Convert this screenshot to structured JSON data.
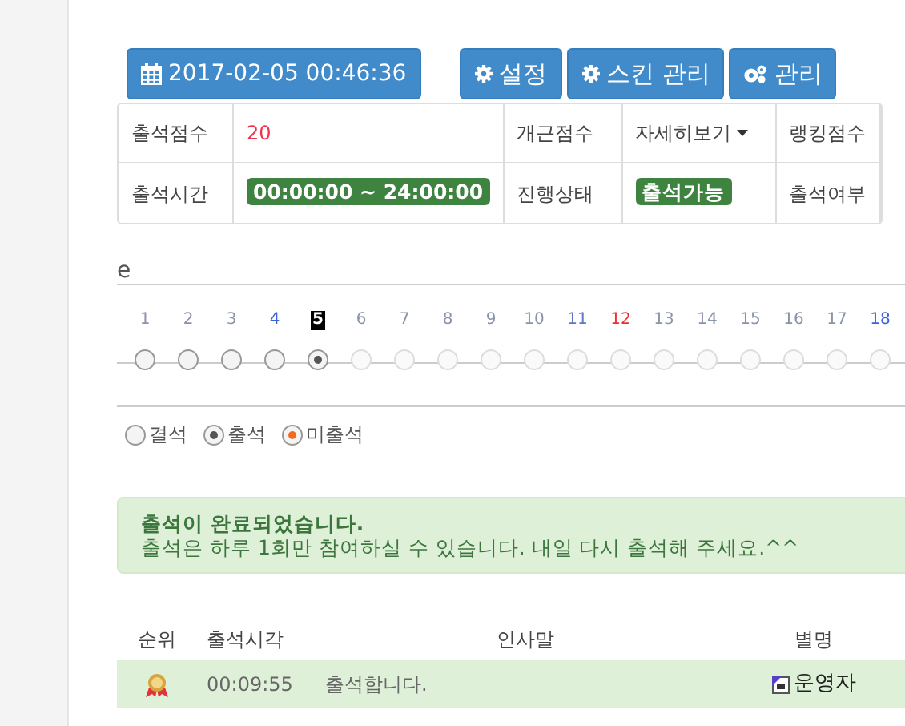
{
  "toolbar": {
    "datetime": "2017-02-05 00:46:36",
    "buttons": [
      {
        "label": "설정",
        "kind": "setting"
      },
      {
        "label": "스킨 관리",
        "kind": "setting"
      },
      {
        "label": "관리",
        "kind": "admin"
      }
    ]
  },
  "info_table": {
    "rows": [
      {
        "cells": [
          {
            "kind": "label",
            "text": "출석점수"
          },
          {
            "kind": "score",
            "text": "20"
          },
          {
            "kind": "label",
            "text": "개근점수"
          },
          {
            "kind": "dropdown",
            "text": "자세히보기"
          },
          {
            "kind": "label",
            "text": "랭킹점수"
          }
        ]
      },
      {
        "cells": [
          {
            "kind": "label",
            "text": "출석시간"
          },
          {
            "kind": "badge",
            "text": "00:00:00 ~ 24:00:00"
          },
          {
            "kind": "label",
            "text": "진행상태"
          },
          {
            "kind": "badge",
            "text": "출석가능"
          },
          {
            "kind": "label",
            "text": "출석여부"
          }
        ]
      }
    ]
  },
  "heading": "e",
  "calendar": {
    "days": [
      {
        "label": "1",
        "color": "#8a94a8",
        "attended": false,
        "disabled": false,
        "today": false
      },
      {
        "label": "2",
        "color": "#8a94a8",
        "attended": false,
        "disabled": false,
        "today": false
      },
      {
        "label": "3",
        "color": "#8a94a8",
        "attended": false,
        "disabled": false,
        "today": false
      },
      {
        "label": "4",
        "color": "#3a62d6",
        "attended": false,
        "disabled": false,
        "today": false
      },
      {
        "label": "5",
        "attended": true,
        "disabled": false,
        "today": true
      },
      {
        "label": "6",
        "color": "#8a94a8",
        "attended": false,
        "disabled": true,
        "today": false
      },
      {
        "label": "7",
        "color": "#8a94a8",
        "attended": false,
        "disabled": true,
        "today": false
      },
      {
        "label": "8",
        "color": "#8a94a8",
        "attended": false,
        "disabled": true,
        "today": false
      },
      {
        "label": "9",
        "color": "#8a94a8",
        "attended": false,
        "disabled": true,
        "today": false
      },
      {
        "label": "10",
        "color": "#8a94a8",
        "attended": false,
        "disabled": true,
        "today": false
      },
      {
        "label": "11",
        "color": "#5a78c8",
        "attended": false,
        "disabled": true,
        "today": false
      },
      {
        "label": "12",
        "color": "#f03030",
        "attended": false,
        "disabled": true,
        "today": false
      },
      {
        "label": "13",
        "color": "#8a94a8",
        "attended": false,
        "disabled": true,
        "today": false
      },
      {
        "label": "14",
        "color": "#8a94a8",
        "attended": false,
        "disabled": true,
        "today": false
      },
      {
        "label": "15",
        "color": "#8a94a8",
        "attended": false,
        "disabled": true,
        "today": false
      },
      {
        "label": "16",
        "color": "#8a94a8",
        "attended": false,
        "disabled": true,
        "today": false
      },
      {
        "label": "17",
        "color": "#8a94a8",
        "attended": false,
        "disabled": true,
        "today": false
      },
      {
        "label": "18",
        "color": "#3a62d6",
        "attended": false,
        "disabled": true,
        "today": false
      }
    ]
  },
  "legend": [
    {
      "label": "결석",
      "kind": "absent"
    },
    {
      "label": "출석",
      "kind": "present"
    },
    {
      "label": "미출석",
      "kind": "missed"
    }
  ],
  "alert": {
    "title": "출석이 완료되었습니다.",
    "message": "출석은 하루 1회만 참여하실 수 있습니다. 내일 다시 출석해 주세요.^^"
  },
  "ranking": {
    "columns": [
      "순위",
      "출석시각",
      "인사말",
      "별명"
    ],
    "rows": [
      {
        "time": "00:09:55",
        "greeting": "출석합니다.",
        "nickname": "운영자"
      }
    ]
  }
}
